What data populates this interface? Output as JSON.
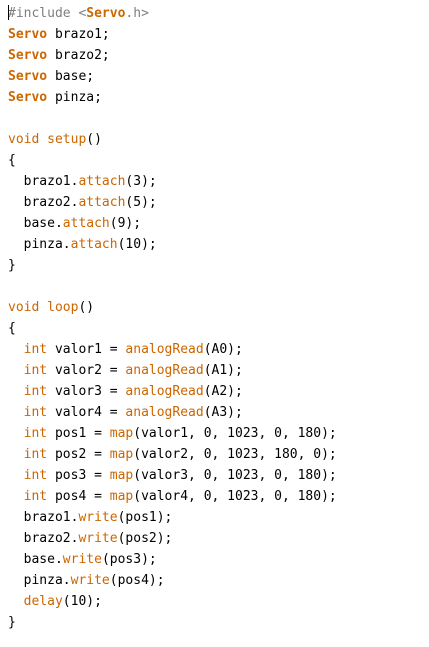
{
  "editor": {
    "language": "arduino",
    "colors": {
      "background": "#ffffff",
      "plain": "#000000",
      "keyword": "#CC6600",
      "directive": "#7E7E7E",
      "header": "#006699"
    },
    "lines": [
      [
        {
          "t": "#include ",
          "k": "directive"
        },
        {
          "t": "<",
          "k": "directive"
        },
        {
          "t": "Servo",
          "k": "type"
        },
        {
          "t": ".h>",
          "k": "directive"
        }
      ],
      [
        {
          "t": "Servo",
          "k": "type"
        },
        {
          "t": " brazo1;",
          "k": "plain"
        }
      ],
      [
        {
          "t": "Servo",
          "k": "type"
        },
        {
          "t": " brazo2;",
          "k": "plain"
        }
      ],
      [
        {
          "t": "Servo",
          "k": "type"
        },
        {
          "t": " base;",
          "k": "plain"
        }
      ],
      [
        {
          "t": "Servo",
          "k": "type"
        },
        {
          "t": " pinza;",
          "k": "plain"
        }
      ],
      [],
      [
        {
          "t": "void",
          "k": "keyword"
        },
        {
          "t": " ",
          "k": "plain"
        },
        {
          "t": "setup",
          "k": "func"
        },
        {
          "t": "()",
          "k": "plain"
        }
      ],
      [
        {
          "t": "{",
          "k": "plain"
        }
      ],
      [
        {
          "t": "  brazo1.",
          "k": "plain"
        },
        {
          "t": "attach",
          "k": "func"
        },
        {
          "t": "(3);",
          "k": "plain"
        }
      ],
      [
        {
          "t": "  brazo2.",
          "k": "plain"
        },
        {
          "t": "attach",
          "k": "func"
        },
        {
          "t": "(5);",
          "k": "plain"
        }
      ],
      [
        {
          "t": "  base.",
          "k": "plain"
        },
        {
          "t": "attach",
          "k": "func"
        },
        {
          "t": "(9);",
          "k": "plain"
        }
      ],
      [
        {
          "t": "  pinza.",
          "k": "plain"
        },
        {
          "t": "attach",
          "k": "func"
        },
        {
          "t": "(10);",
          "k": "plain"
        }
      ],
      [
        {
          "t": "}",
          "k": "plain"
        }
      ],
      [],
      [
        {
          "t": "void",
          "k": "keyword"
        },
        {
          "t": " ",
          "k": "plain"
        },
        {
          "t": "loop",
          "k": "func"
        },
        {
          "t": "()",
          "k": "plain"
        }
      ],
      [
        {
          "t": "{",
          "k": "plain"
        }
      ],
      [
        {
          "t": "  ",
          "k": "plain"
        },
        {
          "t": "int",
          "k": "keyword"
        },
        {
          "t": " valor1 = ",
          "k": "plain"
        },
        {
          "t": "analogRead",
          "k": "func"
        },
        {
          "t": "(A0);",
          "k": "plain"
        }
      ],
      [
        {
          "t": "  ",
          "k": "plain"
        },
        {
          "t": "int",
          "k": "keyword"
        },
        {
          "t": " valor2 = ",
          "k": "plain"
        },
        {
          "t": "analogRead",
          "k": "func"
        },
        {
          "t": "(A1);",
          "k": "plain"
        }
      ],
      [
        {
          "t": "  ",
          "k": "plain"
        },
        {
          "t": "int",
          "k": "keyword"
        },
        {
          "t": " valor3 = ",
          "k": "plain"
        },
        {
          "t": "analogRead",
          "k": "func"
        },
        {
          "t": "(A2);",
          "k": "plain"
        }
      ],
      [
        {
          "t": "  ",
          "k": "plain"
        },
        {
          "t": "int",
          "k": "keyword"
        },
        {
          "t": " valor4 = ",
          "k": "plain"
        },
        {
          "t": "analogRead",
          "k": "func"
        },
        {
          "t": "(A3);",
          "k": "plain"
        }
      ],
      [
        {
          "t": "  ",
          "k": "plain"
        },
        {
          "t": "int",
          "k": "keyword"
        },
        {
          "t": " pos1 = ",
          "k": "plain"
        },
        {
          "t": "map",
          "k": "func"
        },
        {
          "t": "(valor1, 0, 1023, 0, 180);",
          "k": "plain"
        }
      ],
      [
        {
          "t": "  ",
          "k": "plain"
        },
        {
          "t": "int",
          "k": "keyword"
        },
        {
          "t": " pos2 = ",
          "k": "plain"
        },
        {
          "t": "map",
          "k": "func"
        },
        {
          "t": "(valor2, 0, 1023, 180, 0);",
          "k": "plain"
        }
      ],
      [
        {
          "t": "  ",
          "k": "plain"
        },
        {
          "t": "int",
          "k": "keyword"
        },
        {
          "t": " pos3 = ",
          "k": "plain"
        },
        {
          "t": "map",
          "k": "func"
        },
        {
          "t": "(valor3, 0, 1023, 0, 180);",
          "k": "plain"
        }
      ],
      [
        {
          "t": "  ",
          "k": "plain"
        },
        {
          "t": "int",
          "k": "keyword"
        },
        {
          "t": " pos4 = ",
          "k": "plain"
        },
        {
          "t": "map",
          "k": "func"
        },
        {
          "t": "(valor4, 0, 1023, 0, 180);",
          "k": "plain"
        }
      ],
      [
        {
          "t": "  brazo1.",
          "k": "plain"
        },
        {
          "t": "write",
          "k": "func"
        },
        {
          "t": "(pos1);",
          "k": "plain"
        }
      ],
      [
        {
          "t": "  brazo2.",
          "k": "plain"
        },
        {
          "t": "write",
          "k": "func"
        },
        {
          "t": "(pos2);",
          "k": "plain"
        }
      ],
      [
        {
          "t": "  base.",
          "k": "plain"
        },
        {
          "t": "write",
          "k": "func"
        },
        {
          "t": "(pos3);",
          "k": "plain"
        }
      ],
      [
        {
          "t": "  pinza.",
          "k": "plain"
        },
        {
          "t": "write",
          "k": "func"
        },
        {
          "t": "(pos4);",
          "k": "plain"
        }
      ],
      [
        {
          "t": "  ",
          "k": "plain"
        },
        {
          "t": "delay",
          "k": "func"
        },
        {
          "t": "(10);",
          "k": "plain"
        }
      ],
      [
        {
          "t": "}",
          "k": "plain"
        }
      ]
    ]
  }
}
